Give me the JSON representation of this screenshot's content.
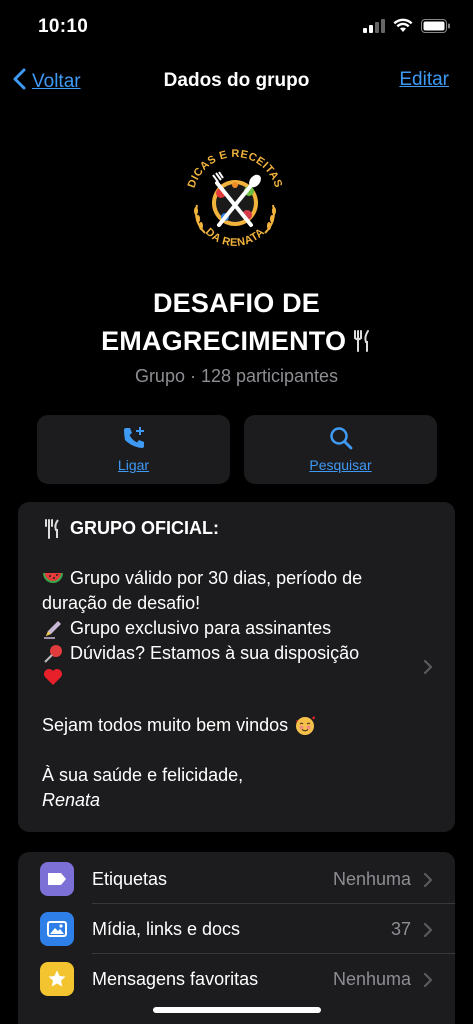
{
  "status": {
    "time": "10:10"
  },
  "nav": {
    "back_label": "Voltar",
    "title": "Dados do grupo",
    "edit_label": "Editar"
  },
  "logo": {
    "top_text": "DICAS E RECEITAS",
    "bottom_text": "DA RENATA"
  },
  "group": {
    "title_line1": "DESAFIO DE",
    "title_line2": "EMAGRECIMENTO",
    "subtitle": "Grupo · 128 participantes"
  },
  "actions": {
    "call_label": "Ligar",
    "search_label": "Pesquisar"
  },
  "description": {
    "heading": "GRUPO OFICIAL:",
    "line1a": "Grupo válido por 30 dias, período de",
    "line1b": "duração de desafio!",
    "line2": "Grupo exclusivo para assinantes",
    "line3": "Dúvidas? Estamos à sua disposição",
    "welcome": "Sejam todos muito bem vindos",
    "closing": "À sua saúde e felicidade,",
    "signature": "Renata"
  },
  "list": {
    "items": [
      {
        "label": "Etiquetas",
        "value": "Nenhuma",
        "icon": "tag-icon",
        "color": "#7c6fd6"
      },
      {
        "label": "Mídia, links e docs",
        "value": "37",
        "icon": "photo-icon",
        "color": "#2f7fe8"
      },
      {
        "label": "Mensagens favoritas",
        "value": "Nenhuma",
        "icon": "star-icon",
        "color": "#f4c430"
      }
    ]
  },
  "colors": {
    "accent": "#3e9af5",
    "card": "#1c1c1e",
    "secondary_text": "#8d8d93"
  }
}
